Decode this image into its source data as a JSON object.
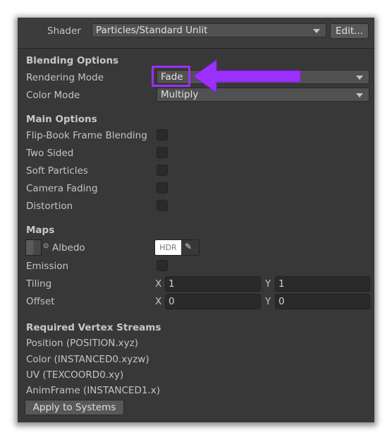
{
  "shader": {
    "label": "Shader",
    "value": "Particles/Standard Unlit",
    "edit_label": "Edit..."
  },
  "blending": {
    "title": "Blending Options",
    "rendering_mode_label": "Rendering Mode",
    "rendering_mode_value": "Fade",
    "color_mode_label": "Color Mode",
    "color_mode_value": "Multiply"
  },
  "main_options": {
    "title": "Main Options",
    "items": [
      {
        "label": "Flip-Book Frame Blending",
        "checked": false
      },
      {
        "label": "Two Sided",
        "checked": false
      },
      {
        "label": "Soft Particles",
        "checked": false
      },
      {
        "label": "Camera Fading",
        "checked": false
      },
      {
        "label": "Distortion",
        "checked": false
      }
    ]
  },
  "maps": {
    "title": "Maps",
    "albedo_label": "Albedo",
    "hdr_label": "HDR",
    "emission_label": "Emission",
    "emission_checked": false,
    "tiling_label": "Tiling",
    "tiling_x": "1",
    "tiling_y": "1",
    "offset_label": "Offset",
    "offset_x": "0",
    "offset_y": "0",
    "x_label": "X",
    "y_label": "Y"
  },
  "vertex_streams": {
    "title": "Required Vertex Streams",
    "items": [
      "Position (POSITION.xyz)",
      "Color (INSTANCED0.xyzw)",
      "UV (TEXCOORD0.xy)",
      "AnimFrame (INSTANCED1.x)"
    ],
    "apply_label": "Apply to Systems"
  },
  "annotation": {
    "color": "#9b30ff",
    "icon": "arrow-left-icon"
  }
}
